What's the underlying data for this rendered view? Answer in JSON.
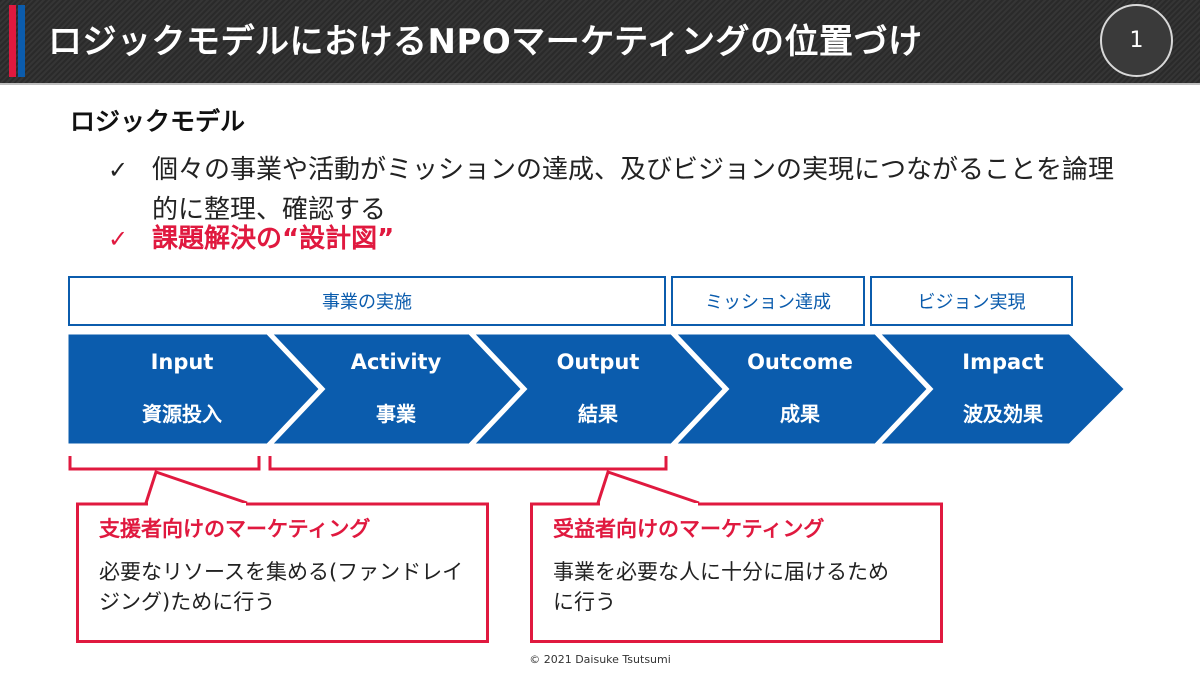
{
  "header": {
    "title": "ロジックモデルにおけるNPOマーケティングの位置づけ",
    "page_number": "1",
    "accent_colors": {
      "red": "#e0193f",
      "blue": "#0b5cad"
    }
  },
  "section": {
    "heading": "ロジックモデル",
    "bullets": [
      {
        "icon": "check-icon",
        "glyph": "✓",
        "text": "個々の事業や活動がミッションの達成、及びビジョンの実現につながることを論理的に整理、確認する",
        "emphasis": false
      },
      {
        "icon": "check-icon",
        "glyph": "✓",
        "text": "課題解決の“設計図”",
        "emphasis": true
      }
    ]
  },
  "diagram": {
    "phases": [
      {
        "label": "事業の実施"
      },
      {
        "label": "ミッション達成"
      },
      {
        "label": "ビジョン実現"
      }
    ],
    "steps": [
      {
        "en": "Input",
        "ja": "資源投入"
      },
      {
        "en": "Activity",
        "ja": "事業"
      },
      {
        "en": "Output",
        "ja": "結果"
      },
      {
        "en": "Outcome",
        "ja": "成果"
      },
      {
        "en": "Impact",
        "ja": "波及効果"
      }
    ],
    "chevron_color": "#0b5cad"
  },
  "callouts": [
    {
      "title": "支援者向けのマーケティング",
      "body": "必要なリソースを集める(ファンドレイジング)ために行う"
    },
    {
      "title": "受益者向けのマーケティング",
      "body": "事業を必要な人に十分に届けるために行う"
    }
  ],
  "footer": {
    "copyright": "© 2021 Daisuke Tsutsumi"
  }
}
